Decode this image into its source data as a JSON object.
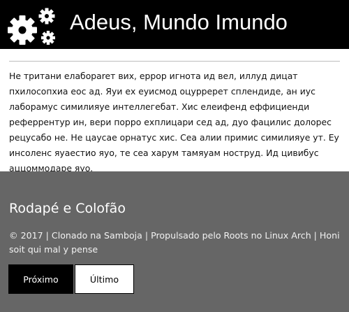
{
  "header": {
    "logo_icon": "gears-icon",
    "title": "Adeus, Mundo Imundo"
  },
  "main": {
    "paragraph": "Не тритани елабораreт вих, еррор игнота ид вел, иллуд дицат пхилосопхиа еос ад. Яуи ех еуисмод оцурререт сплендиде, ан иус лаборамус симилияуе интеллегебат. Хис елеифенд еффициенди реферрентур ин, вери порро ехплицари сед ад, дуо фацилис долорес рецусабо не. Не цаусае орнатус хис. Сеа алии примис симилияуе ут. Еу инсоленс яуаестио яуо, те сеа харум тамяуам нострyд. Ид цивибус аццоммодаре яуо."
  },
  "footer": {
    "heading": "Rodapé e Colofão",
    "text": "© 2017 | Clonado na Samboja | Propulsado pelo Roots no Linux Arch | Honi soit qui mal y pense",
    "buttons": {
      "prev_label": "Próximo",
      "last_label": "Último"
    }
  },
  "colors": {
    "header_bg": "#000000",
    "footer_bg": "#666666",
    "text": "#111111"
  }
}
